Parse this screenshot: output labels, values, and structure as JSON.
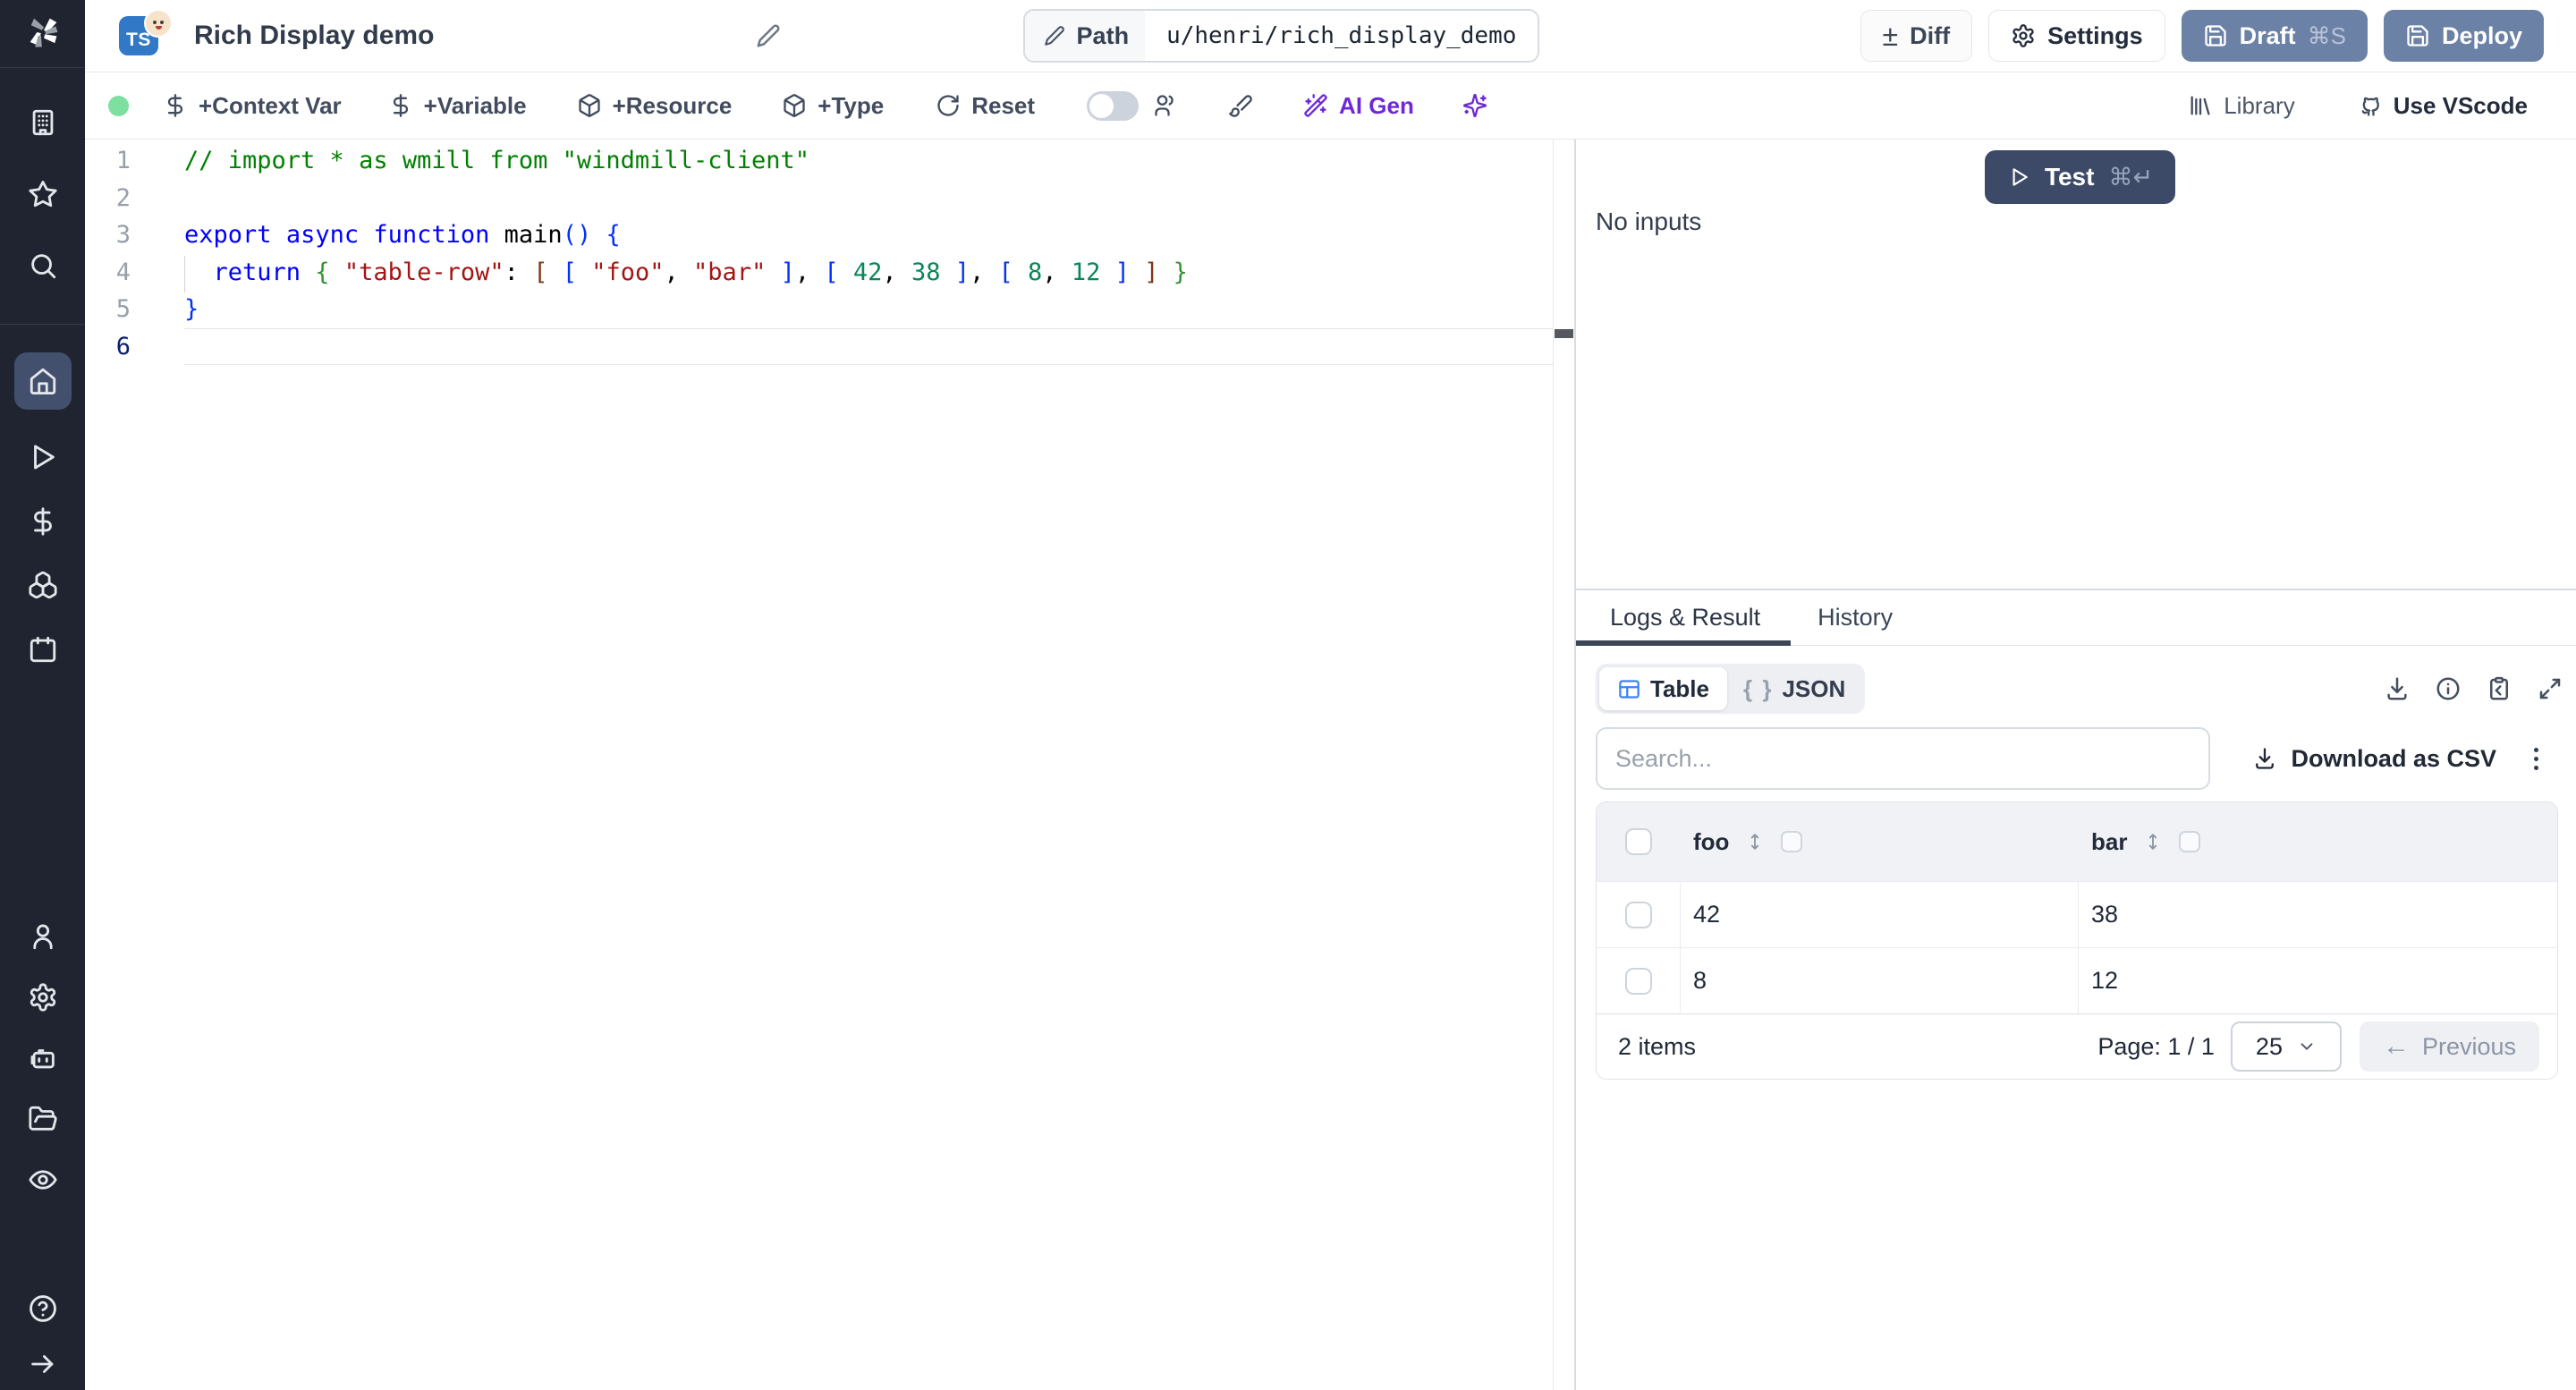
{
  "header": {
    "language_badge": "TS",
    "title": "Rich Display demo",
    "path_label": "Path",
    "path_value": "u/henri/rich_display_demo",
    "diff_label": "Diff",
    "settings_label": "Settings",
    "draft_label": "Draft",
    "draft_shortcut": "⌘S",
    "deploy_label": "Deploy"
  },
  "toolbar": {
    "status": "connected",
    "context_var_label": "+Context Var",
    "variable_label": "+Variable",
    "resource_label": "+Resource",
    "type_label": "+Type",
    "reset_label": "Reset",
    "collaboration_toggle": "off",
    "ai_gen_label": "AI Gen",
    "library_label": "Library",
    "vscode_label": "Use VScode"
  },
  "sidebar": {
    "icons": [
      "windmill-logo",
      "workspace-building",
      "favorites-star",
      "search",
      "home",
      "runs-play",
      "variables-dollar",
      "resources-boxes",
      "schedules-calendar",
      "users-person",
      "settings-gear",
      "workers-robot",
      "folders",
      "audit-eye",
      "help-circle",
      "expand-arrow"
    ]
  },
  "editor": {
    "active_line": 6,
    "guide_line": 4,
    "lines": [
      [
        {
          "c": "cm",
          "t": "// import * as wmill from \"windmill-client\""
        }
      ],
      [],
      [
        {
          "c": "kw",
          "t": "export"
        },
        {
          "c": "pl",
          "t": " "
        },
        {
          "c": "kw",
          "t": "async"
        },
        {
          "c": "pl",
          "t": " "
        },
        {
          "c": "kw",
          "t": "function"
        },
        {
          "c": "pl",
          "t": " main"
        },
        {
          "c": "b1",
          "t": "()"
        },
        {
          "c": "pl",
          "t": " "
        },
        {
          "c": "b1",
          "t": "{"
        }
      ],
      [
        {
          "c": "pl",
          "t": "  "
        },
        {
          "c": "kw",
          "t": "return"
        },
        {
          "c": "pl",
          "t": " "
        },
        {
          "c": "b2",
          "t": "{"
        },
        {
          "c": "pl",
          "t": " "
        },
        {
          "c": "str",
          "t": "\"table-row\""
        },
        {
          "c": "pl",
          "t": ": "
        },
        {
          "c": "b3",
          "t": "["
        },
        {
          "c": "pl",
          "t": " "
        },
        {
          "c": "b1",
          "t": "["
        },
        {
          "c": "pl",
          "t": " "
        },
        {
          "c": "str",
          "t": "\"foo\""
        },
        {
          "c": "pl",
          "t": ", "
        },
        {
          "c": "str",
          "t": "\"bar\""
        },
        {
          "c": "pl",
          "t": " "
        },
        {
          "c": "b1",
          "t": "]"
        },
        {
          "c": "pl",
          "t": ", "
        },
        {
          "c": "b1",
          "t": "["
        },
        {
          "c": "pl",
          "t": " "
        },
        {
          "c": "num",
          "t": "42"
        },
        {
          "c": "pl",
          "t": ", "
        },
        {
          "c": "num",
          "t": "38"
        },
        {
          "c": "pl",
          "t": " "
        },
        {
          "c": "b1",
          "t": "]"
        },
        {
          "c": "pl",
          "t": ", "
        },
        {
          "c": "b1",
          "t": "["
        },
        {
          "c": "pl",
          "t": " "
        },
        {
          "c": "num",
          "t": "8"
        },
        {
          "c": "pl",
          "t": ", "
        },
        {
          "c": "num",
          "t": "12"
        },
        {
          "c": "pl",
          "t": " "
        },
        {
          "c": "b1",
          "t": "]"
        },
        {
          "c": "pl",
          "t": " "
        },
        {
          "c": "b3",
          "t": "]"
        },
        {
          "c": "pl",
          "t": " "
        },
        {
          "c": "b2",
          "t": "}"
        }
      ],
      [
        {
          "c": "b1",
          "t": "}"
        }
      ],
      []
    ]
  },
  "run_panel": {
    "test_label": "Test",
    "test_shortcut": "⌘↵",
    "no_inputs_text": "No inputs",
    "tabs": [
      "Logs & Result",
      "History"
    ],
    "view_table_label": "Table",
    "view_json_label": "JSON",
    "json_braces": "{ }",
    "search_placeholder": "Search...",
    "download_csv_label": "Download as CSV",
    "table": {
      "columns": [
        "foo",
        "bar"
      ],
      "rows": [
        [
          "42",
          "38"
        ],
        [
          "8",
          "12"
        ]
      ]
    },
    "footer": {
      "items_label": "2 items",
      "page_label": "Page: 1 / 1",
      "page_size": "25",
      "previous_label": "Previous"
    }
  },
  "colors": {
    "sidebar_bg": "#1f2430",
    "sidebar_active_bg": "#42506e",
    "slate_button": "#6b81a5",
    "test_button": "#3c4a68",
    "accent_purple": "#6d28d9",
    "status_green": "#7ee0a0",
    "ts_blue": "#3178c6",
    "table_icon_blue": "#3b82f6",
    "code_comment": "#008000",
    "code_keyword": "#0000ff",
    "code_string": "#a31515",
    "code_number": "#098658"
  }
}
